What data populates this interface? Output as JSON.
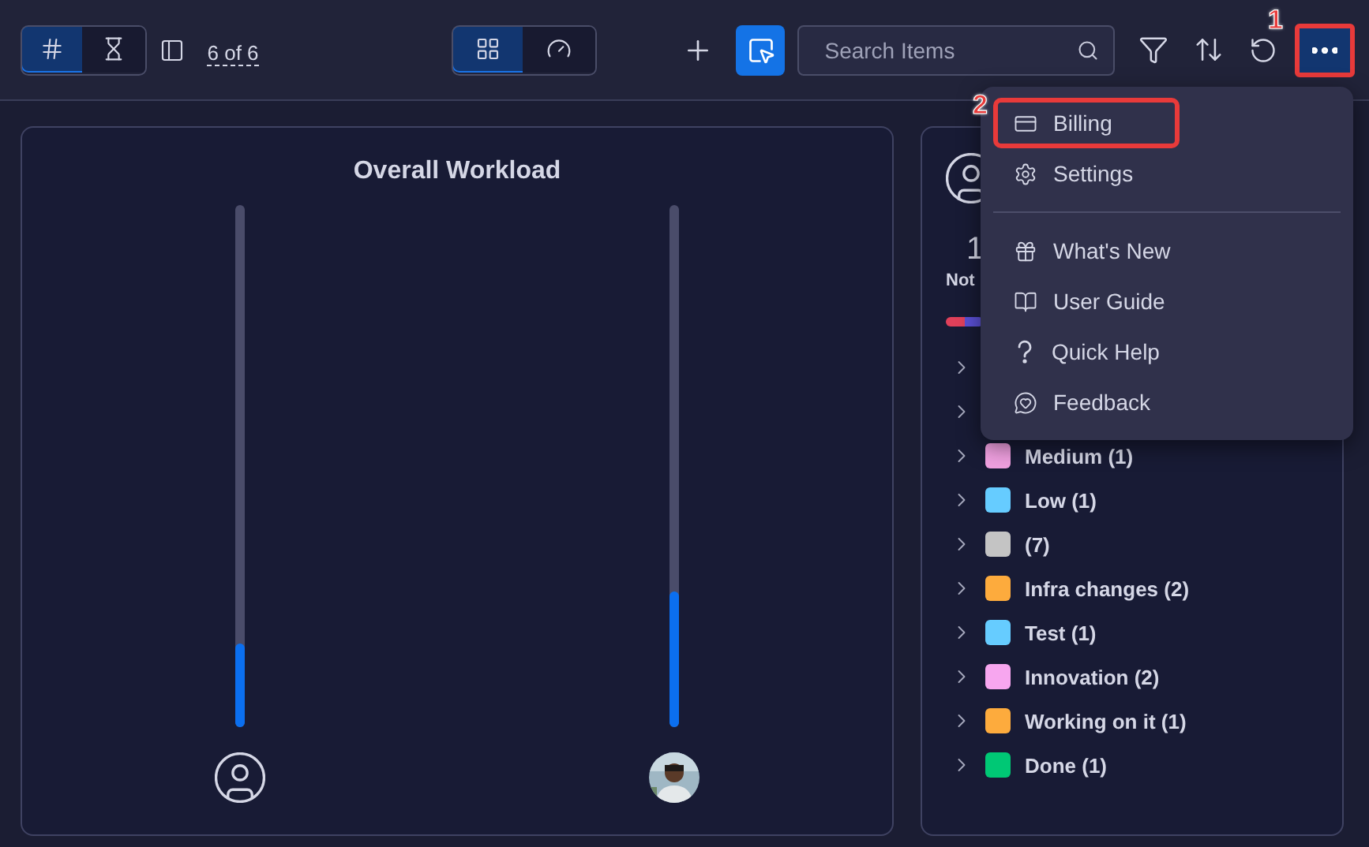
{
  "toolbar": {
    "mode_toggle": [
      {
        "kind": "hash",
        "selected": true
      },
      {
        "kind": "hourglass",
        "selected": false
      }
    ],
    "count": "6 of 6",
    "view_toggle": [
      {
        "kind": "grid",
        "selected": true
      },
      {
        "kind": "gauge",
        "selected": false
      }
    ],
    "search": {
      "placeholder": "Search Items"
    },
    "more_button": {
      "selected": true,
      "highlighted": true,
      "annotation": "1"
    }
  },
  "workload": {
    "title": "Overall Workload",
    "people": [
      {
        "kind": "generic",
        "level": 0.16
      },
      {
        "level": 0.26
      }
    ]
  },
  "summary": {
    "count": "1",
    "label": "Not",
    "bar_segments": [
      {
        "color": "#e0405a"
      },
      {
        "color": "#5b50d6"
      }
    ],
    "groups": [
      {
        "kind": "covered"
      },
      {
        "kind": "covered"
      },
      {
        "kind": "group",
        "label": "Medium (1)",
        "color": "#f0a0e0"
      },
      {
        "kind": "group",
        "label": "Low (1)",
        "color": "#66ccff"
      },
      {
        "kind": "group",
        "label": "(7)",
        "color": "#c4c4c4"
      },
      {
        "kind": "group",
        "label": "Infra changes (2)",
        "color": "#fdab3d"
      },
      {
        "kind": "group",
        "label": "Test (1)",
        "color": "#66ccff"
      },
      {
        "kind": "group",
        "label": "Innovation (2)",
        "color": "#f7a6ef"
      },
      {
        "kind": "group",
        "label": "Working on it (1)",
        "color": "#fdab3d"
      },
      {
        "kind": "group",
        "label": "Done (1)",
        "color": "#00c875"
      }
    ]
  },
  "menu": {
    "sections": [
      [
        {
          "kind": "billing",
          "label": "Billing",
          "highlighted": true,
          "annotation": "2"
        },
        {
          "kind": "settings",
          "label": "Settings",
          "highlighted": false
        }
      ],
      [
        {
          "kind": "whats_new",
          "label": "What's New",
          "highlighted": false
        },
        {
          "kind": "guide",
          "label": "User Guide",
          "highlighted": false
        },
        {
          "kind": "help",
          "label": "Quick Help",
          "highlighted": false
        },
        {
          "kind": "feedback",
          "label": "Feedback",
          "highlighted": false
        }
      ]
    ]
  }
}
